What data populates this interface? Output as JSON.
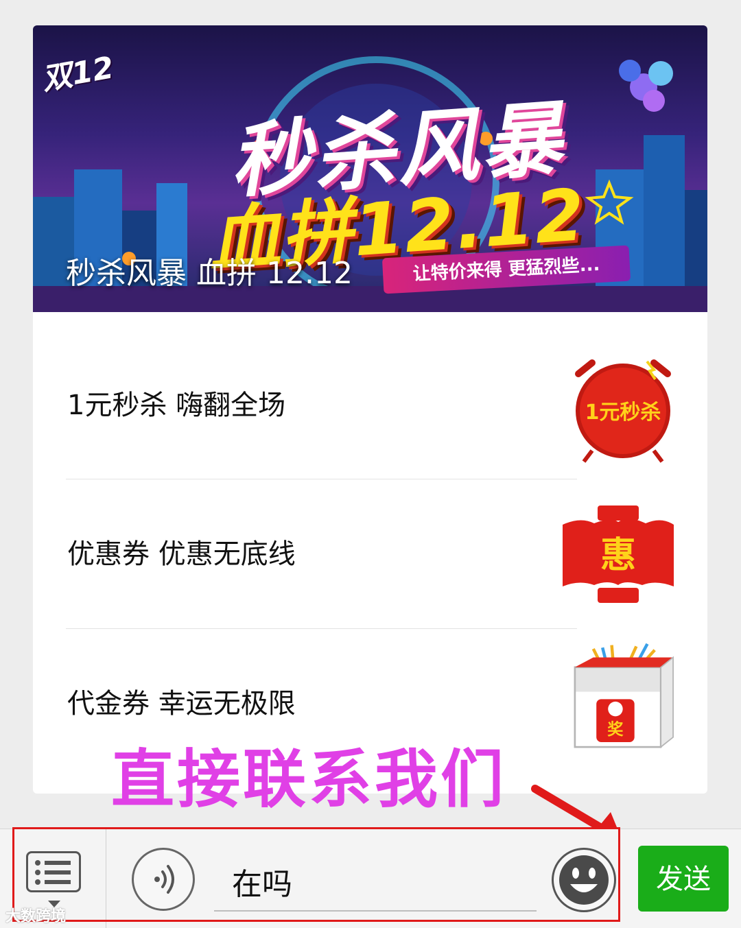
{
  "banner": {
    "tag": "双12",
    "headline": "秒杀风暴",
    "subline": "血拼12.12",
    "ribbon": "让特价来得 更猛烈些...",
    "caption": "秒杀风暴 血拼 12.12"
  },
  "list": {
    "items": [
      {
        "label": "1元秒杀 嗨翻全场",
        "icon": "one-yuan-seckill-alarm-icon",
        "icon_text": "1元秒杀"
      },
      {
        "label": "优惠券 优惠无底线",
        "icon": "discount-envelope-icon",
        "icon_text": "惠"
      },
      {
        "label": "代金券 幸运无极限",
        "icon": "lucky-box-icon",
        "icon_text": "奖"
      }
    ]
  },
  "annotation": {
    "text": "直接联系我们",
    "color": "#e040e6"
  },
  "inputbar": {
    "menu_icon": "menu-list-icon",
    "voice_icon": "voice-icon",
    "text_value": "在吗",
    "emoji_icon": "emoji-icon",
    "send_label": "发送"
  },
  "watermark": "大数跨境",
  "colors": {
    "send": "#1aad19",
    "highlight": "#e01a1a",
    "background": "#ededed"
  }
}
